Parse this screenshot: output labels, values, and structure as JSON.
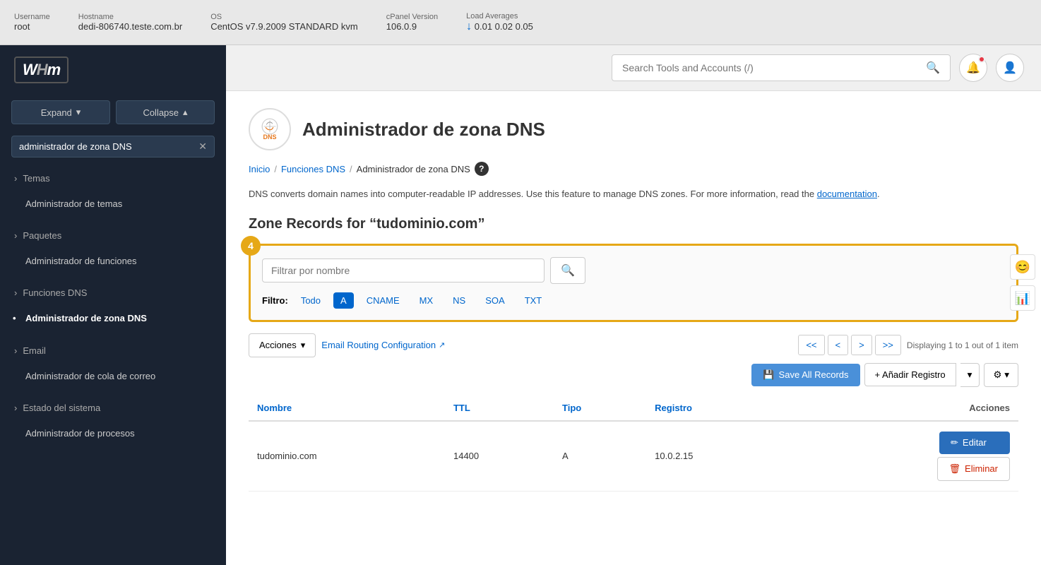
{
  "topbar": {
    "username_label": "Username",
    "username_value": "root",
    "hostname_label": "Hostname",
    "hostname_value": "dedi-806740.teste.com.br",
    "os_label": "OS",
    "os_value": "CentOS v7.9.2009 STANDARD kvm",
    "cpanel_label": "cPanel Version",
    "cpanel_value": "106.0.9",
    "load_label": "Load Averages",
    "load_values": "0.01  0.02  0.05"
  },
  "sidebar": {
    "logo": "WHm",
    "expand_label": "Expand",
    "collapse_label": "Collapse",
    "search_placeholder": "administrador de zona DNS",
    "sections": [
      {
        "name": "temas",
        "label": "Temas",
        "items": [
          "Administrador de temas"
        ]
      },
      {
        "name": "paquetes",
        "label": "Paquetes",
        "items": [
          "Administrador de funciones"
        ]
      },
      {
        "name": "funciones-dns",
        "label": "Funciones DNS",
        "items": [
          "Administrador de zona DNS"
        ]
      },
      {
        "name": "email",
        "label": "Email",
        "items": [
          "Administrador de cola de correo"
        ]
      },
      {
        "name": "estado-sistema",
        "label": "Estado del sistema",
        "items": [
          "Administrador de procesos"
        ]
      }
    ]
  },
  "header": {
    "search_placeholder": "Search Tools and Accounts (/)"
  },
  "page": {
    "title": "Administrador de zona DNS",
    "icon_label": "DNS",
    "breadcrumb": {
      "inicio": "Inicio",
      "funciones_dns": "Funciones DNS",
      "current": "Administrador de zona DNS"
    },
    "description": "DNS converts domain names into computer-readable IP addresses. Use this feature to manage DNS zones. For more information, read the",
    "doc_link": "documentation",
    "zone_title": "Zone Records for “tudominio.com”",
    "filter": {
      "placeholder": "Filtrar por nombre",
      "label": "Filtro:",
      "types": [
        "Todo",
        "A",
        "CNAME",
        "MX",
        "NS",
        "SOA",
        "TXT"
      ],
      "active_type": "A"
    },
    "pagination": {
      "first": "<<",
      "prev": "<",
      "next": ">",
      "last": ">>",
      "info": "Displaying 1 to 1 out of 1 item"
    },
    "toolbar": {
      "acciones_label": "Acciones",
      "email_routing_label": "Email Routing Configuration",
      "save_all_label": "Save All Records",
      "add_registro_label": "+ Añadir Registro"
    },
    "table": {
      "columns": [
        "Nombre",
        "TTL",
        "Tipo",
        "Registro",
        "Acciones"
      ],
      "rows": [
        {
          "nombre": "tudominio.com",
          "ttl": "14400",
          "tipo": "A",
          "registro": "10.0.2.15"
        }
      ]
    },
    "row_actions": {
      "edit_label": "Editar",
      "delete_label": "Eliminar"
    },
    "step_number": "4"
  }
}
